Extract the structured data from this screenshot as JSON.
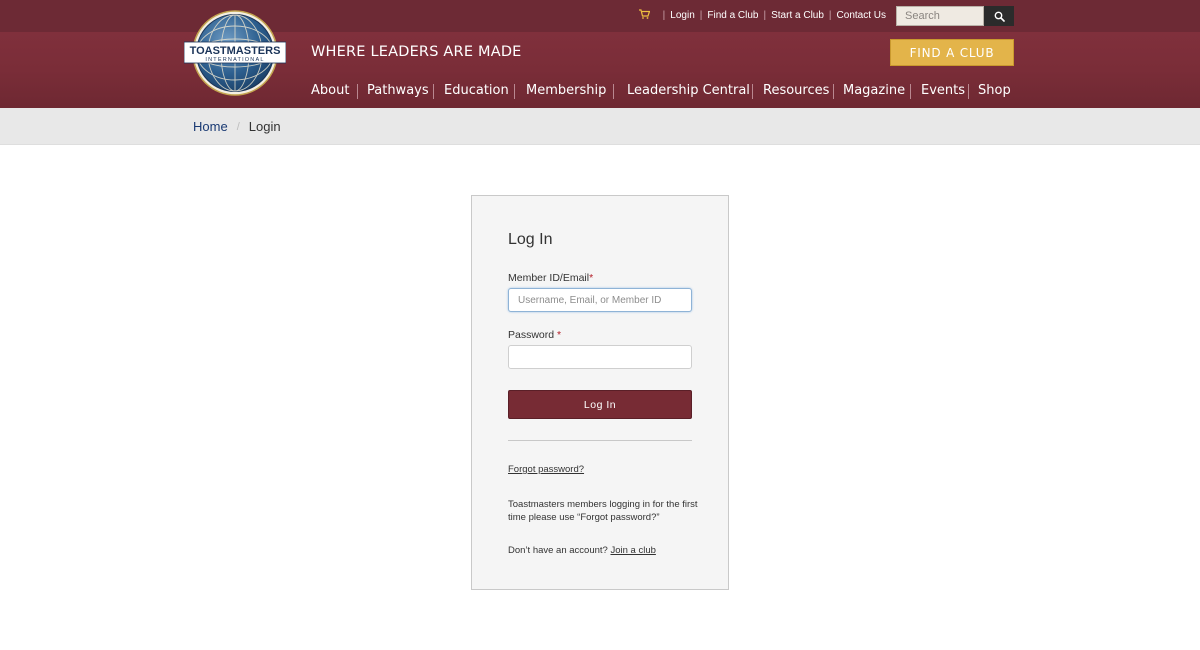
{
  "header": {
    "logo_text": "TOASTMASTERS",
    "logo_subtext": "INTERNATIONAL",
    "tagline": "WHERE LEADERS ARE MADE",
    "utility_links": [
      "Login",
      "Find a Club",
      "Start a Club",
      "Contact Us"
    ],
    "search_placeholder": "Search",
    "find_club_label": "FIND A CLUB",
    "nav": [
      "About",
      "Pathways",
      "Education",
      "Membership",
      "Leadership Central",
      "Resources",
      "Magazine",
      "Events",
      "Shop"
    ],
    "icons": {
      "cart": "cart-icon",
      "search": "search-icon",
      "logo": "globe-logo"
    },
    "colors": {
      "header_bg": "#7a2d38",
      "accent_gold": "#e3b44a"
    }
  },
  "breadcrumb": {
    "home": "Home",
    "separator": "/",
    "current": "Login"
  },
  "login": {
    "title": "Log In",
    "member_label": "Member ID/Email",
    "member_placeholder": "Username, Email, or Member ID",
    "member_value": "",
    "password_label": "Password ",
    "password_value": "",
    "required_mark": "*",
    "submit_label": "Log In",
    "forgot_label": "Forgot password?",
    "first_time_note": "Toastmasters members logging in for the first time please use “Forgot password?”",
    "no_account_text": "Don’t have an account? ",
    "join_label": "Join a club",
    "button_color": "#772b34"
  }
}
